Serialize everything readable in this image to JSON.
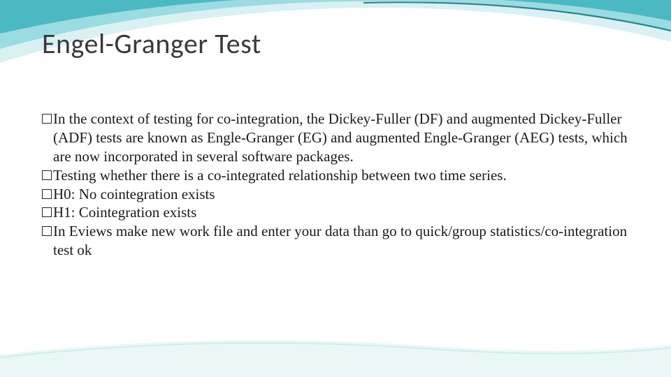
{
  "title": "Engel-Granger Test",
  "bullets": [
    "In the context of testing for co-integration, the Dickey-Fuller (DF) and augmented Dickey-Fuller (ADF) tests are known as Engle-Granger (EG) and augmented Engle-Granger (AEG) tests, which are now incorporated in several software packages.",
    "Testing whether there is a co-integrated relationship between two time series.",
    "H0: No cointegration exists",
    "H1: Cointegration exists",
    "In Eviews make new work file and enter your data than go to quick/group statistics/co-integration test ok"
  ]
}
